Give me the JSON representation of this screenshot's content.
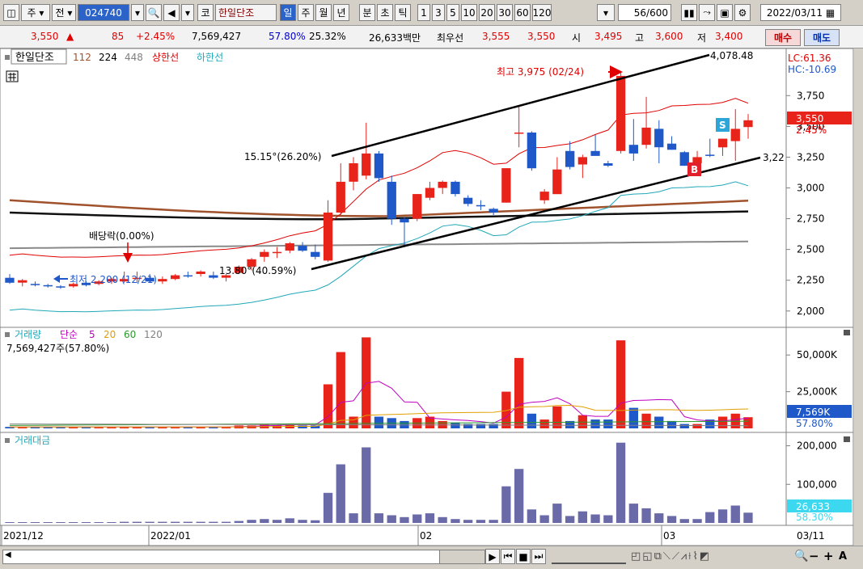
{
  "toolbar": {
    "market": "주",
    "scope": "전",
    "code": "024740",
    "ko_badge": "코",
    "stock_name": "한일단조",
    "periods": [
      "일",
      "주",
      "월",
      "년",
      "분",
      "초",
      "틱"
    ],
    "period_selected": "일",
    "minutes": [
      "1",
      "3",
      "5",
      "10",
      "20",
      "30",
      "60",
      "120"
    ],
    "count": "56",
    "count_total": "/600",
    "date": "2022/03/11"
  },
  "quote": {
    "price": "3,550",
    "arrow": "▲",
    "change": "85",
    "change_pct": "+2.45%",
    "volume": "7,569,427",
    "vol_ratio": "57.80%",
    "turnover": "25.32%",
    "amount": "26,633백만",
    "best_ask_label": "최우선",
    "best_ask": "3,555",
    "best_bid": "3,550",
    "open_label": "시",
    "open": "3,495",
    "high_label": "고",
    "high": "3,600",
    "low_label": "저",
    "low": "3,400",
    "buy": "매수",
    "sell": "매도"
  },
  "price_panel": {
    "name": "한일단조",
    "ma_labels": [
      "112",
      "224",
      "448"
    ],
    "upper_band": "상한선",
    "lower_band": "하한선",
    "lc": "LC:61.36",
    "hc": "HC:-10.69",
    "price_tag": "3,550",
    "pct_tag": "2.45%",
    "annotations": {
      "high": "최고 3,975 (02/24)",
      "low": "최저 2,200 (12/21)",
      "dividend": "배당락(0.00%)",
      "trend_upper": "15.15°(26.20%)",
      "trend_lower": "13.80°(40.59%)",
      "trend_end_top": "4,078.48",
      "trend_end_bottom": "3,22",
      "signal_s": "S",
      "signal_b": "B"
    }
  },
  "volume_panel": {
    "title": "거래량",
    "ma_label": "단순",
    "ma_periods": [
      "5",
      "20",
      "60",
      "120"
    ],
    "value_text": "7,569,427주(57.80%)",
    "tag": "7,569K",
    "tag_pct": "57.80%"
  },
  "amount_panel": {
    "title": "거래대금",
    "tag": "26,633",
    "tag_pct": "58.30%"
  },
  "colors": {
    "up": "#e8231a",
    "down": "#1f58c8",
    "ma_red": "#e00000",
    "band_cyan": "#20a8b8",
    "amount": "#6a6aa8"
  },
  "chart_data": {
    "type": "candlestick",
    "x_labels": [
      "2021/12",
      "2022/01",
      "02",
      "03",
      "03/11"
    ],
    "price_axis": [
      "3,750",
      "3,500",
      "3,250",
      "3,000",
      "2,750",
      "2,500",
      "2,250",
      "2,000"
    ],
    "price_ylim": [
      1900,
      4100
    ],
    "volume_axis": [
      "50,000K",
      "25,000K"
    ],
    "amount_axis": [
      "200,000",
      "100,000"
    ],
    "candles": [
      [
        2270,
        2300,
        2220,
        2230
      ],
      [
        2230,
        2260,
        2200,
        2250
      ],
      [
        2220,
        2240,
        2200,
        2210
      ],
      [
        2210,
        2220,
        2190,
        2200
      ],
      [
        2200,
        2210,
        2180,
        2190
      ],
      [
        2200,
        2230,
        2190,
        2220
      ],
      [
        2230,
        2240,
        2200,
        2210
      ],
      [
        2220,
        2250,
        2210,
        2240
      ],
      [
        2240,
        2270,
        2220,
        2260
      ],
      [
        2240,
        2320,
        2230,
        2260
      ],
      [
        2260,
        2320,
        2230,
        2270
      ],
      [
        2270,
        2300,
        2230,
        2240
      ],
      [
        2240,
        2280,
        2220,
        2260
      ],
      [
        2260,
        2300,
        2250,
        2290
      ],
      [
        2290,
        2320,
        2270,
        2280
      ],
      [
        2300,
        2330,
        2280,
        2320
      ],
      [
        2290,
        2320,
        2260,
        2270
      ],
      [
        2270,
        2300,
        2240,
        2290
      ],
      [
        2310,
        2370,
        2300,
        2360
      ],
      [
        2360,
        2430,
        2330,
        2420
      ],
      [
        2440,
        2500,
        2400,
        2480
      ],
      [
        2470,
        2520,
        2430,
        2480
      ],
      [
        2490,
        2560,
        2470,
        2550
      ],
      [
        2530,
        2560,
        2480,
        2490
      ],
      [
        2480,
        2540,
        2420,
        2440
      ],
      [
        2410,
        2900,
        2400,
        2800
      ],
      [
        2800,
        3200,
        2780,
        3050
      ],
      [
        3050,
        3250,
        2980,
        3200
      ],
      [
        3100,
        3530,
        3070,
        3280
      ],
      [
        3280,
        3300,
        3050,
        3080
      ],
      [
        3050,
        3100,
        2700,
        2750
      ],
      [
        2750,
        2760,
        2520,
        2720
      ],
      [
        2750,
        2950,
        2730,
        2950
      ],
      [
        2920,
        3050,
        2900,
        3000
      ],
      [
        3000,
        3060,
        2950,
        3050
      ],
      [
        3050,
        3060,
        2930,
        2950
      ],
      [
        2920,
        2940,
        2850,
        2870
      ],
      [
        2860,
        2900,
        2820,
        2850
      ],
      [
        2830,
        2840,
        2780,
        2800
      ],
      [
        2880,
        3160,
        2880,
        3160
      ],
      [
        3450,
        3670,
        3330,
        3450
      ],
      [
        3450,
        3460,
        3140,
        3160
      ],
      [
        2900,
        2990,
        2870,
        2970
      ],
      [
        2950,
        3250,
        2950,
        3150
      ],
      [
        3300,
        3380,
        3150,
        3170
      ],
      [
        3190,
        3270,
        3080,
        3250
      ],
      [
        3300,
        3430,
        3280,
        3260
      ],
      [
        3200,
        3220,
        3170,
        3180
      ],
      [
        3300,
        3950,
        3280,
        3910
      ],
      [
        3350,
        3560,
        3220,
        3280
      ],
      [
        3350,
        3740,
        3320,
        3490
      ],
      [
        3480,
        3550,
        3200,
        3330
      ],
      [
        3360,
        3420,
        3310,
        3310
      ],
      [
        3290,
        3300,
        3180,
        3180
      ],
      [
        3200,
        3300,
        3150,
        3250
      ],
      [
        3270,
        3400,
        3250,
        3260
      ],
      [
        3330,
        3400,
        3260,
        3400
      ],
      [
        3380,
        3640,
        3220,
        3480
      ],
      [
        3495,
        3600,
        3400,
        3550
      ]
    ],
    "volume_mk": [
      1,
      1,
      1,
      1,
      1,
      1,
      1,
      1,
      1,
      1,
      1,
      1,
      1,
      1,
      1,
      1,
      1,
      1,
      2,
      2,
      3,
      2,
      3,
      2,
      2,
      30,
      52,
      8,
      62,
      8,
      7,
      5,
      7,
      8,
      5,
      4,
      3,
      3,
      3,
      25,
      48,
      10,
      6,
      15,
      5,
      9,
      6,
      6,
      60,
      14,
      10,
      8,
      5,
      3,
      3,
      6,
      8,
      10,
      7.6
    ],
    "amount_bn": [
      2,
      2,
      2,
      2,
      2,
      2,
      2,
      2,
      2,
      3,
      3,
      3,
      3,
      3,
      3,
      3,
      3,
      3,
      5,
      8,
      10,
      8,
      12,
      8,
      7,
      78,
      152,
      25,
      196,
      25,
      20,
      15,
      22,
      25,
      15,
      10,
      8,
      8,
      8,
      95,
      140,
      35,
      20,
      50,
      18,
      30,
      22,
      20,
      208,
      50,
      38,
      25,
      18,
      10,
      10,
      28,
      35,
      45,
      26.6
    ]
  }
}
